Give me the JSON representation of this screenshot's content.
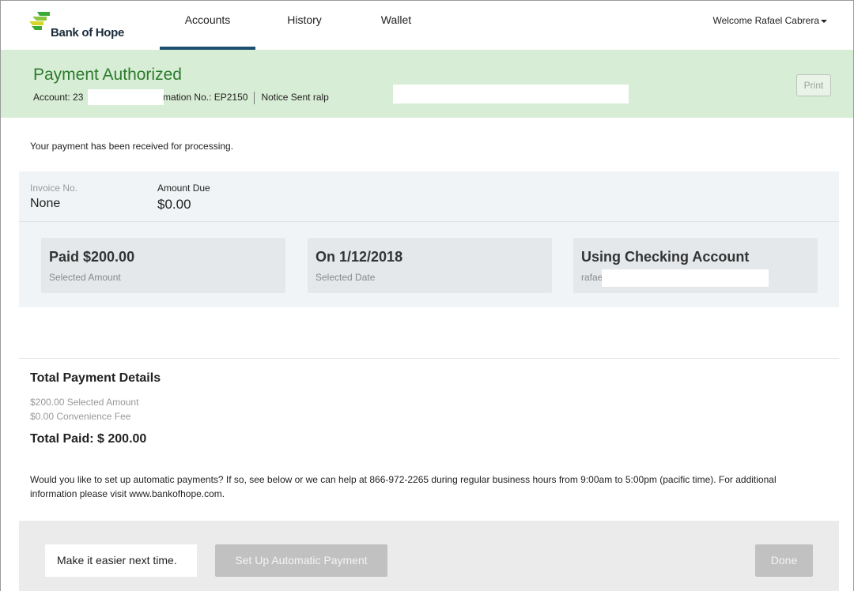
{
  "brand": {
    "name": "Bank of Hope"
  },
  "nav": {
    "tabs": [
      {
        "label": "Accounts",
        "active": true
      },
      {
        "label": "History",
        "active": false
      },
      {
        "label": "Wallet",
        "active": false
      }
    ],
    "welcome": "Welcome Rafael Cabrera"
  },
  "banner": {
    "title": "Payment Authorized",
    "account": "Account: 23",
    "confirmation": "nfirmation No.: EP2150",
    "notice": "Notice Sent ralp",
    "print_label": "Print"
  },
  "message": "Your payment has been received for processing.",
  "invoice": {
    "invoice_label": "Invoice No.",
    "invoice_value": "None",
    "amount_label": "Amount Due",
    "amount_value": "$0.00"
  },
  "cards": [
    {
      "title": "Paid $200.00",
      "sub": "Selected Amount"
    },
    {
      "title": "On 1/12/2018",
      "sub": "Selected Date"
    },
    {
      "title": "Using Checking Account",
      "sub": "rafae"
    }
  ],
  "totals": {
    "title": "Total Payment Details",
    "selected": "$200.00 Selected Amount",
    "fee": "$0.00 Convenience Fee",
    "total": "Total Paid: $ 200.00"
  },
  "auto_message": "Would you like to set up automatic payments? If so, see below or we can help at 866-972-2265 during regular business hours from 9:00am to 5:00pm (pacific time). For additional information please visit www.bankofhope.com.",
  "footer": {
    "label": "Make it easier next time.",
    "setup_button": "Set Up Automatic Payment",
    "done_button": "Done"
  },
  "colors": {
    "banner_bg": "#d8edd5",
    "banner_title": "#2c7a2e",
    "nav_active": "#1d4f6e",
    "logo_green": "#3aa935",
    "logo_yellow": "#d6d62a",
    "button_disabled": "#c1c1c1"
  }
}
